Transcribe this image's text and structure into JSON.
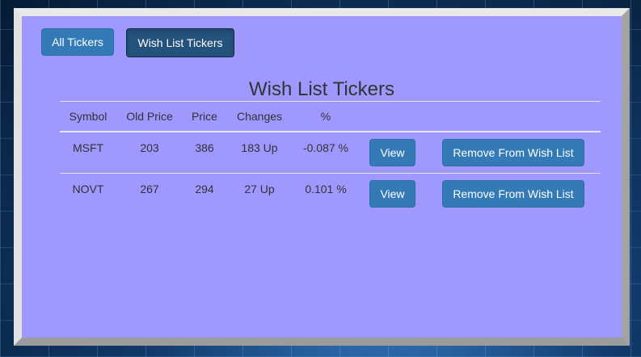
{
  "nav": {
    "all_tickers_label": "All Tickers",
    "wish_list_label": "Wish List Tickers"
  },
  "page": {
    "title": "Wish List Tickers"
  },
  "table": {
    "headers": {
      "symbol": "Symbol",
      "old_price": "Old Price",
      "price": "Price",
      "changes": "Changes",
      "percent": "%"
    },
    "rows": [
      {
        "symbol": "MSFT",
        "old_price": "203",
        "price": "386",
        "changes": "183 Up",
        "percent": "-0.087 %",
        "view_label": "View",
        "remove_label": "Remove From Wish List"
      },
      {
        "symbol": "NOVT",
        "old_price": "267",
        "price": "294",
        "changes": "27 Up",
        "percent": "0.101 %",
        "view_label": "View",
        "remove_label": "Remove From Wish List"
      }
    ]
  },
  "colors": {
    "panel_background": "#9f98fe",
    "button_primary": "#337ab7",
    "button_active": "#23527c"
  }
}
